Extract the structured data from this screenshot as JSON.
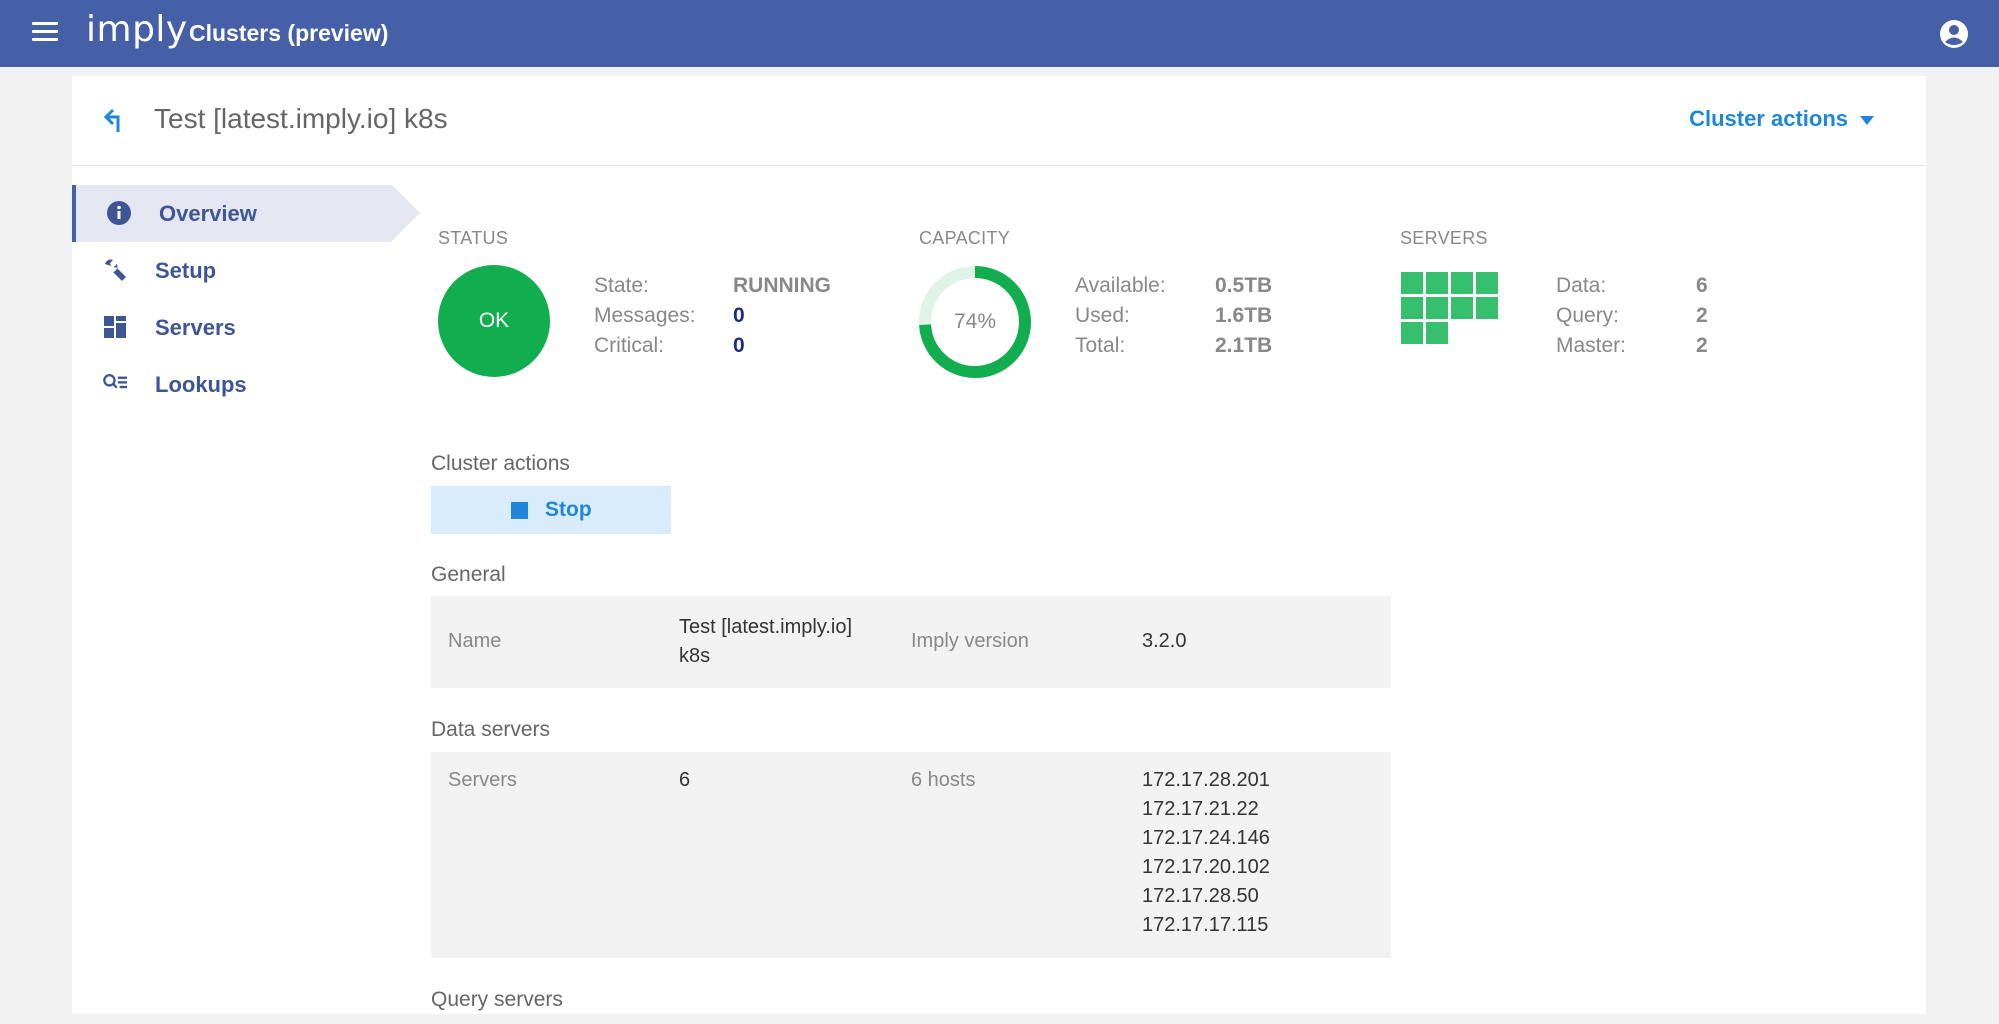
{
  "app": {
    "logo": "imply",
    "title": "Clusters (preview)"
  },
  "header": {
    "cluster_name": "Test [latest.imply.io] k8s",
    "cluster_actions_label": "Cluster actions"
  },
  "sidebar": {
    "items": [
      {
        "label": "Overview",
        "icon": "info-icon",
        "active": true
      },
      {
        "label": "Setup",
        "icon": "wrench-icon",
        "active": false
      },
      {
        "label": "Servers",
        "icon": "grid-icon",
        "active": false
      },
      {
        "label": "Lookups",
        "icon": "lookup-icon",
        "active": false
      }
    ]
  },
  "status": {
    "title": "STATUS",
    "badge": "OK",
    "badge_color": "#12ad4f",
    "rows": [
      {
        "label": "State:",
        "value": "RUNNING"
      },
      {
        "label": "Messages:",
        "value": "0"
      },
      {
        "label": "Critical:",
        "value": "0"
      }
    ]
  },
  "capacity": {
    "title": "CAPACITY",
    "percent_label": "74%",
    "used_fraction": 0.74,
    "ring_color": "#12ad4f",
    "track_color": "#dff3e6",
    "rows": [
      {
        "label": "Available:",
        "value": "0.5TB"
      },
      {
        "label": "Used:",
        "value": "1.6TB"
      },
      {
        "label": "Total:",
        "value": "2.1TB"
      }
    ]
  },
  "servers": {
    "title": "SERVERS",
    "block_color": "#36c06e",
    "rows": [
      {
        "label": "Data:",
        "value": "6"
      },
      {
        "label": "Query:",
        "value": "2"
      },
      {
        "label": "Master:",
        "value": "2"
      }
    ]
  },
  "cluster_actions": {
    "title": "Cluster actions",
    "stop_label": "Stop"
  },
  "general": {
    "title": "General",
    "name_label": "Name",
    "name_value_line1": "Test [latest.imply.io]",
    "name_value_line2": "k8s",
    "version_label": "Imply version",
    "version_value": "3.2.0"
  },
  "data_servers": {
    "title": "Data servers",
    "servers_label": "Servers",
    "servers_value": "6",
    "hosts_label": "6 hosts",
    "hosts": [
      "172.17.28.201",
      "172.17.21.22",
      "172.17.24.146",
      "172.17.20.102",
      "172.17.28.50",
      "172.17.17.115"
    ]
  },
  "query_servers": {
    "title": "Query servers"
  }
}
